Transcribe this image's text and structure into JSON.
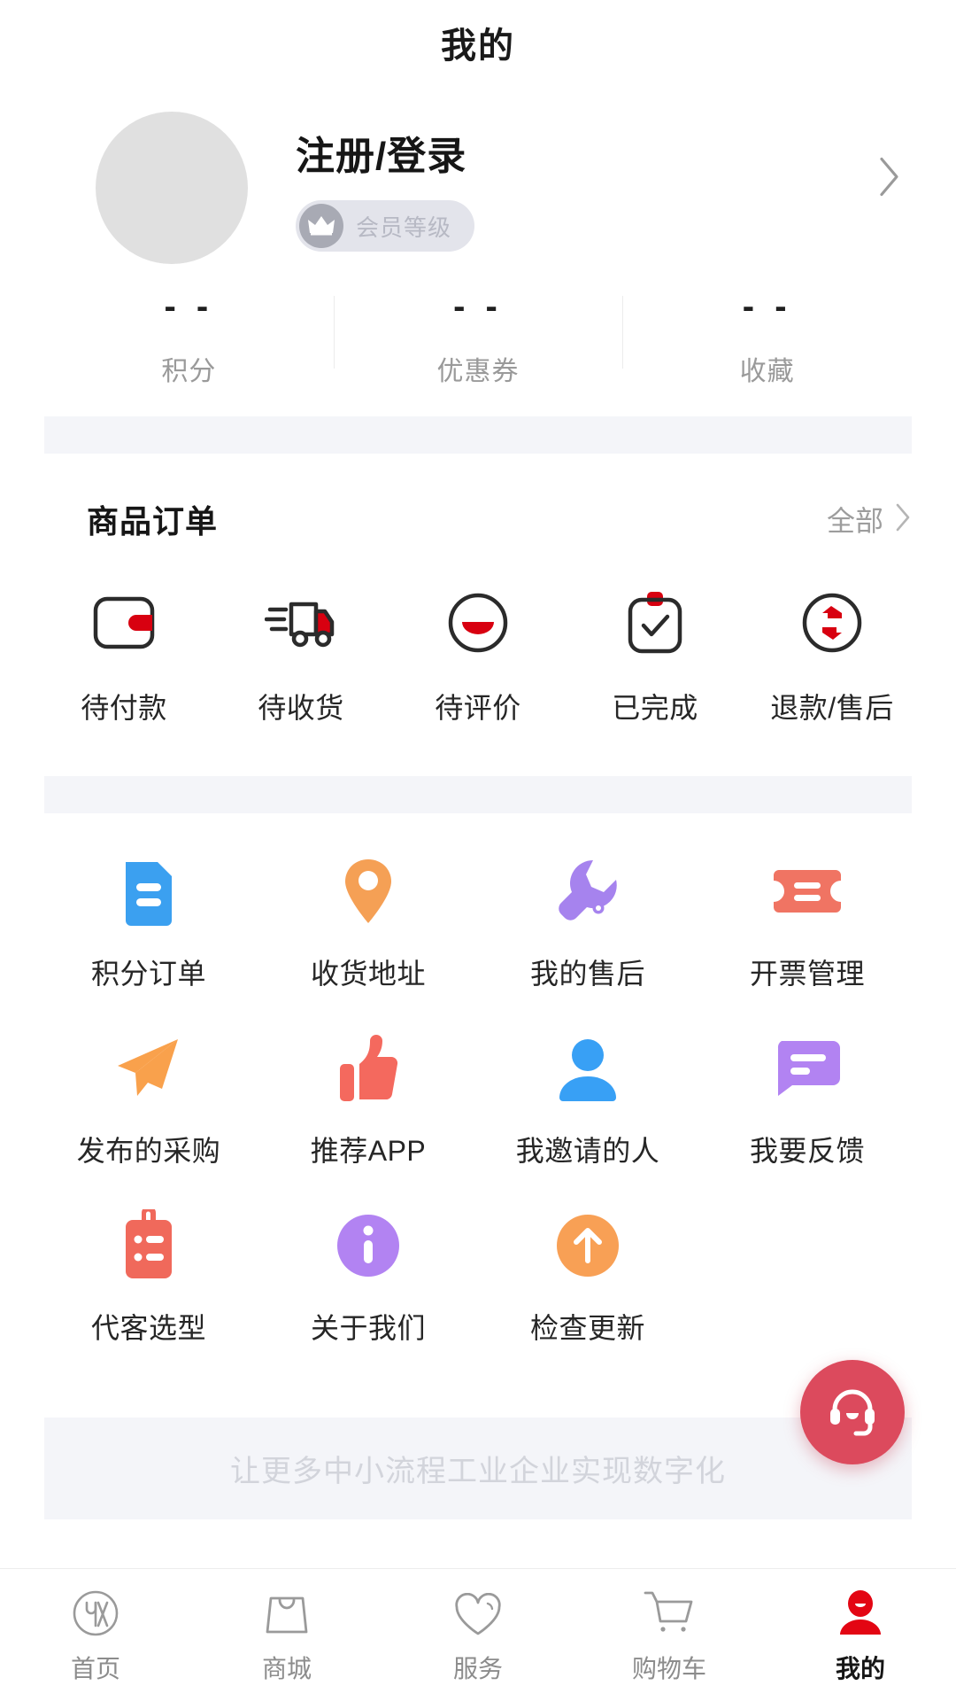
{
  "header": {
    "title": "我的"
  },
  "profile": {
    "login_label": "注册/登录",
    "member_badge": "会员等级",
    "avatar_icon": "avatar-placeholder-icon",
    "crown_icon": "crown-icon",
    "chevron_icon": "chevron-right-icon"
  },
  "stats": [
    {
      "value": "- -",
      "label": "积分"
    },
    {
      "value": "- -",
      "label": "优惠券"
    },
    {
      "value": "- -",
      "label": "收藏"
    }
  ],
  "orders": {
    "title": "商品订单",
    "more_label": "全部",
    "more_icon": "chevron-right-icon",
    "items": [
      {
        "label": "待付款",
        "icon": "wallet-icon"
      },
      {
        "label": "待收货",
        "icon": "delivery-truck-icon"
      },
      {
        "label": "待评价",
        "icon": "comment-circle-icon"
      },
      {
        "label": "已完成",
        "icon": "clipboard-check-icon"
      },
      {
        "label": "退款/售后",
        "icon": "refund-exchange-icon"
      }
    ]
  },
  "menu": [
    {
      "label": "积分订单",
      "icon": "document-icon",
      "color": "#3BA0F0"
    },
    {
      "label": "收货地址",
      "icon": "map-pin-icon",
      "color": "#F5A055"
    },
    {
      "label": "我的售后",
      "icon": "wrench-icon",
      "color": "#A683EE"
    },
    {
      "label": "开票管理",
      "icon": "ticket-icon",
      "color": "#F07463"
    },
    {
      "label": "发布的采购",
      "icon": "paper-plane-icon",
      "color": "#F9A košt"
    },
    {
      "label": "推荐APP",
      "icon": "thumbs-up-icon",
      "color": "#F4695E"
    },
    {
      "label": "我邀请的人",
      "icon": "person-icon",
      "color": "#38A0F5"
    },
    {
      "label": "我要反馈",
      "icon": "speech-bubble-icon",
      "color": "#B283F2"
    },
    {
      "label": "代客选型",
      "icon": "clipboard-list-icon",
      "color": "#F0695B"
    },
    {
      "label": "关于我们",
      "icon": "info-circle-icon",
      "color": "#B283F2"
    },
    {
      "label": "检查更新",
      "icon": "arrow-up-circle-icon",
      "color": "#F8A055"
    }
  ],
  "slogan": {
    "text": "让更多中小流程工业企业实现数字化"
  },
  "fab": {
    "icon": "headset-icon",
    "color": "#DC4A5D"
  },
  "tabbar": [
    {
      "label": "首页",
      "icon": "home-instrument-icon",
      "active": false
    },
    {
      "label": "商城",
      "icon": "shopping-bag-icon",
      "active": false
    },
    {
      "label": "服务",
      "icon": "heart-icon",
      "active": false
    },
    {
      "label": "购物车",
      "icon": "cart-icon",
      "active": false
    },
    {
      "label": "我的",
      "icon": "person-filled-icon",
      "active": true
    }
  ],
  "colors": {
    "accent_red": "#E30613",
    "fab_red": "#DC4A5D",
    "icon_dark": "#2B2B2B",
    "band_gray": "#F4F5F9"
  }
}
